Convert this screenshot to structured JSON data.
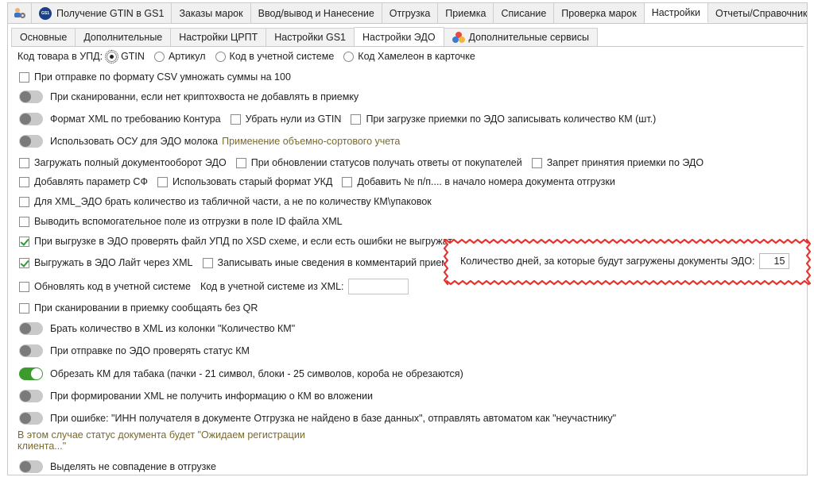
{
  "top_tabs": [
    {
      "label": "Получение GTIN в GS1",
      "active": false
    },
    {
      "label": "Заказы марок",
      "active": false
    },
    {
      "label": "Ввод/вывод и Нанесение",
      "active": false
    },
    {
      "label": "Отгрузка",
      "active": false
    },
    {
      "label": "Приемка",
      "active": false
    },
    {
      "label": "Списание",
      "active": false
    },
    {
      "label": "Проверка марок",
      "active": false
    },
    {
      "label": "Настройки",
      "active": true
    },
    {
      "label": "Отчеты/Справочники",
      "active": false
    }
  ],
  "sub_tabs": [
    {
      "label": "Основные",
      "active": false
    },
    {
      "label": "Дополнительные",
      "active": false
    },
    {
      "label": "Настройки ЦРПТ",
      "active": false
    },
    {
      "label": "Настройки GS1",
      "active": false
    },
    {
      "label": "Настройки ЭДО",
      "active": true
    },
    {
      "label": "Дополнительные сервисы",
      "active": false
    }
  ],
  "upd_code": {
    "label": "Код товара в УПД:",
    "options": [
      "GTIN",
      "Артикул",
      "Код в учетной системе",
      "Код Хамелеон в карточке"
    ],
    "selected": "GTIN"
  },
  "settings": {
    "csv_multiply": "При отправке по формату CSV умножать суммы на 100",
    "no_crypto_tail": "При сканированни, если нет криптохвоста не добавлять в приемку",
    "xml_kontur": "Формат XML по требованию Контура",
    "remove_zeros_gtin": "Убрать нули из GTIN",
    "qty_km_pcs": "При загрузке приемки по ЭДО записывать количество КМ (шт.)",
    "osu_milk": "Использовать ОСУ для ЭДО молока",
    "osu_hint": "Применение объемно-сортового учета",
    "full_docflow": "Загружать полный документооборот ЭДО",
    "buyer_replies": "При обновлении статусов получать ответы от покупателей",
    "deny_receipt": "Запрет принятия приемки по ЭДО",
    "add_sf_param": "Добавлять параметр СФ",
    "old_ukd": "Использовать старый формат УКД",
    "add_number": "Добавить № п/п.... в начало номера документа отгрузки",
    "table_qty": "Для XML_ЭДО брать количество из табличной части, а не по количеству КМ\\упаковок",
    "aux_field": "Выводить вспомогательное поле из отгрузки в поле ID файла XML",
    "xsd_check": "При выгрузке в ЭДО проверять файл УПД по XSD схеме, и если есть ошибки не выгружать",
    "edo_lite": "Выгружать в ЭДО Лайт через XML",
    "other_info": "Записывать иные сведения в комментарий приемки",
    "days_label": "Количество дней, за которые будут загружены документы ЭДО:",
    "days_value": "15",
    "update_code": "Обновлять код в учетной системе",
    "code_from_xml": "Код в учетной системе из XML:",
    "no_qr": "При сканировании в приемку сообщаять без QR",
    "qty_from_col": "Брать количество в XML из колонки \"Количество КМ\"",
    "check_km_status": "При отправке по ЭДО проверять статус КМ",
    "trim_km_tobacco": "Обрезать КМ для табака (пачки - 21 символ, блоки - 25 символов, короба не обрезаются)",
    "no_km_info": "При формировании XML не получить информацию о КМ во вложении",
    "inn_error": "При ошибке: \"ИНН получателя в документе Отгрузка не найдено в базе данных\", отправлять автоматом как \"неучастнику\"",
    "inn_hint_line1": "В этом случае статус документа будет \"Ожидаем регистрации",
    "inn_hint_line2": "клиента...\"",
    "highlight_mismatch": "Выделять не совпадение в отгрузке"
  },
  "colors": {
    "toggle_on": "#3c9a2f",
    "check_green": "#2f9a2f",
    "hint": "#7a6a2a",
    "highlight_outline": "#e3342f"
  }
}
